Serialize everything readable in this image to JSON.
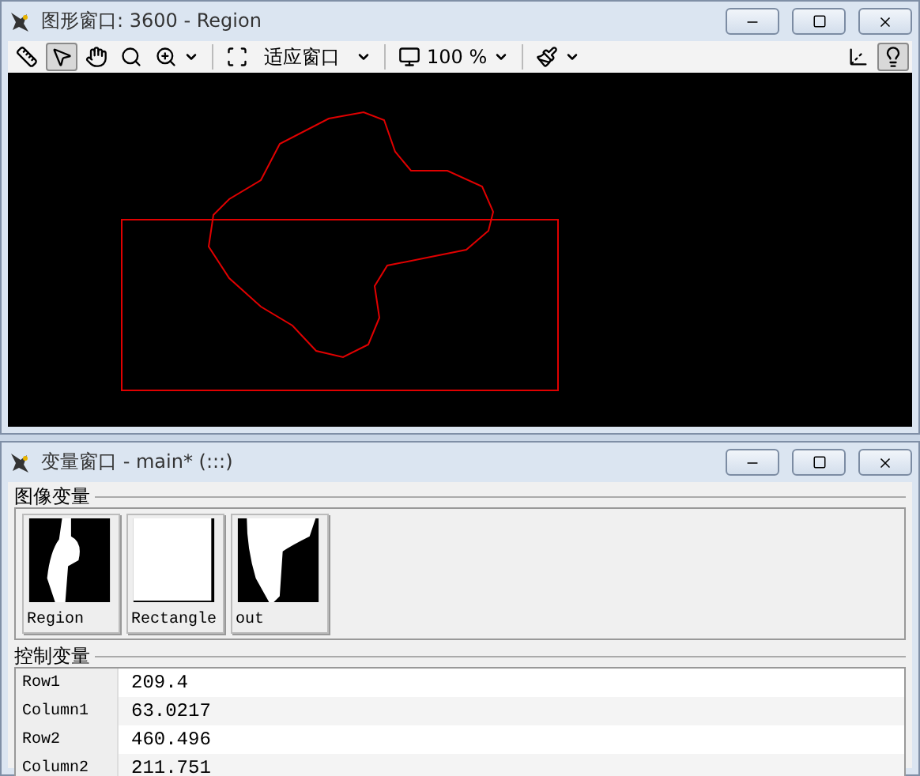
{
  "graphics_window": {
    "title": "图形窗口: 3600 - Region",
    "tools": [
      {
        "kind": "ruler",
        "selected": false
      },
      {
        "kind": "pointer",
        "selected": true
      },
      {
        "kind": "hand",
        "selected": false
      },
      {
        "kind": "magnifier",
        "selected": false
      },
      {
        "kind": "zoom",
        "selected": false,
        "dropdown": true
      },
      {
        "kind": "fit",
        "label": "适应窗口",
        "selected": false,
        "dropdown": true
      },
      {
        "kind": "scale",
        "label": "100 %",
        "selected": false,
        "dropdown": true
      },
      {
        "kind": "paint",
        "selected": false,
        "dropdown": true
      },
      {
        "kind": "spacer"
      },
      {
        "kind": "axes",
        "selected": false
      },
      {
        "kind": "bulb",
        "selected": true
      }
    ]
  },
  "variable_window": {
    "title": "变量窗口 - main* (:::)",
    "image_variables": {
      "label": "图像变量",
      "items": [
        {
          "name": "Region",
          "kind": "region"
        },
        {
          "name": "Rectangle",
          "kind": "rectangle"
        },
        {
          "name": "out",
          "kind": "out"
        }
      ]
    },
    "control_variables": {
      "label": "控制变量",
      "rows": [
        {
          "name": "Row1",
          "value": "209.4"
        },
        {
          "name": "Column1",
          "value": "63.0217"
        },
        {
          "name": "Row2",
          "value": "460.496"
        },
        {
          "name": "Column2",
          "value": "211.751"
        }
      ]
    }
  }
}
